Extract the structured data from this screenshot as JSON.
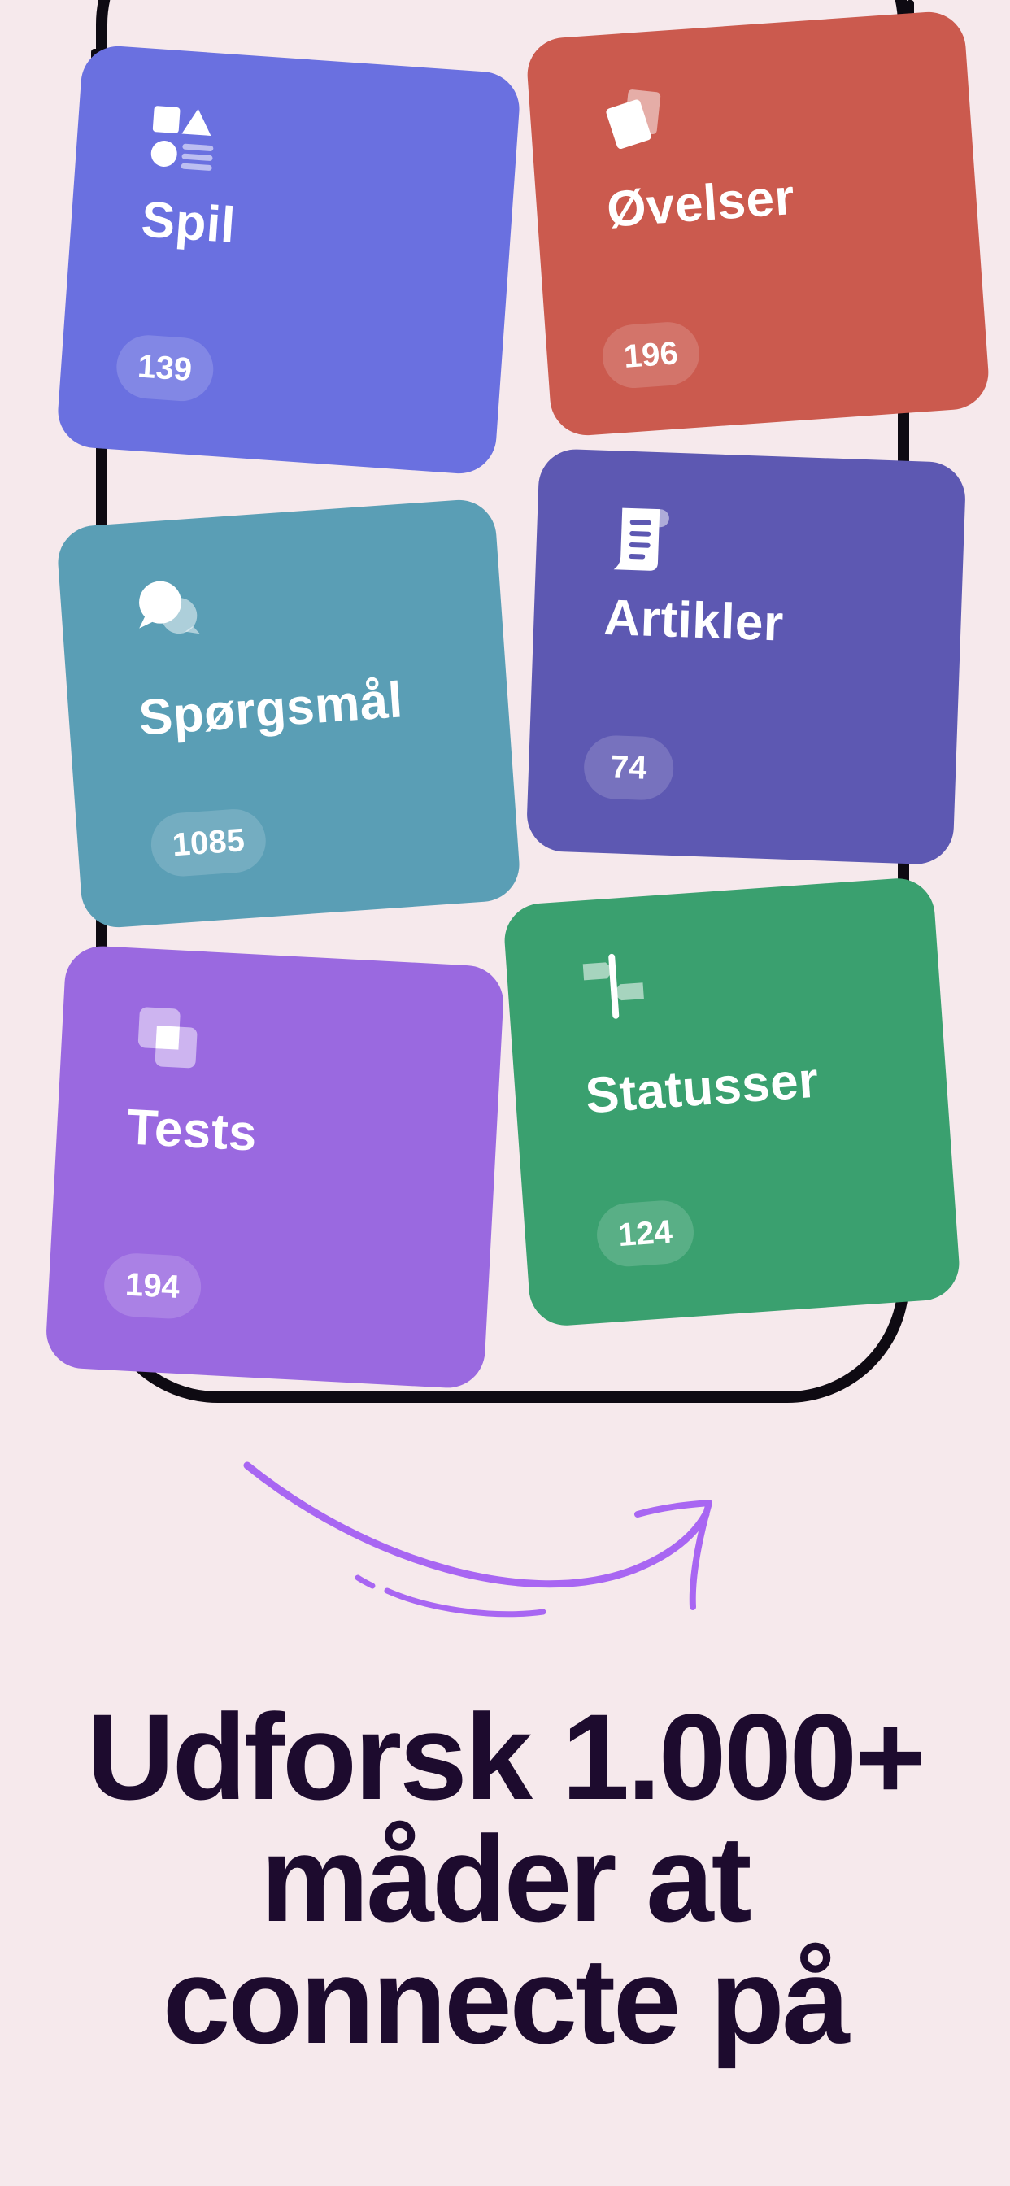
{
  "cards": {
    "spil": {
      "title": "Spil",
      "count": "139",
      "color": "#6A70E0",
      "icon": "shapes-icon"
    },
    "ovelser": {
      "title": "Øvelser",
      "count": "196",
      "color": "#CB5A4E",
      "icon": "cards-icon"
    },
    "sporgsmal": {
      "title": "Spørgsmål",
      "count": "1085",
      "color": "#5A9EB5",
      "icon": "speech-bubbles-icon"
    },
    "artikler": {
      "title": "Artikler",
      "count": "74",
      "color": "#5D58B2",
      "icon": "scroll-document-icon"
    },
    "tests": {
      "title": "Tests",
      "count": "194",
      "color": "#9A69E0",
      "icon": "overlapping-squares-icon"
    },
    "statusser": {
      "title": "Statusser",
      "count": "124",
      "color": "#3AA06F",
      "icon": "signpost-icon"
    }
  },
  "headline": {
    "line1": "Udforsk 1.000+",
    "line2": "måder at",
    "line3": "connecte på"
  },
  "colors": {
    "background": "#F6E9EC",
    "headline": "#1D0B2E",
    "arrow": "#A866F2",
    "phone_frame": "#0E0A12"
  }
}
